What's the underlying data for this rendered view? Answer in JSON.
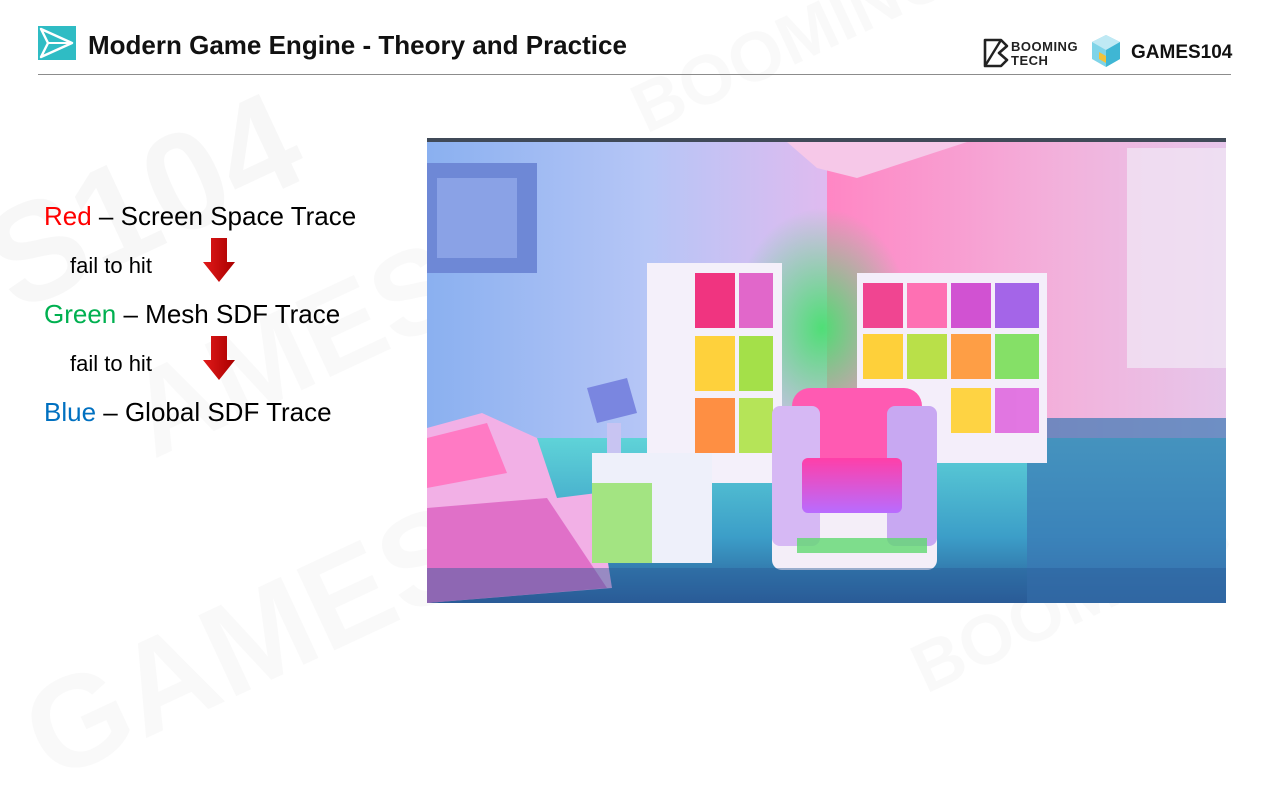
{
  "header": {
    "title": "Modern Game Engine - Theory and Practice",
    "brand_booming": "BOOMING TECH",
    "brand_games": "GAMES104"
  },
  "legend": {
    "red": {
      "color_word": "Red",
      "rest": " – Screen Space Trace",
      "color": "#ff0000"
    },
    "step1": "fail to hit",
    "green": {
      "color_word": "Green",
      "rest": " – Mesh SDF Trace",
      "color": "#00b050"
    },
    "step2": "fail to hit",
    "blue": {
      "color_word": "Blue",
      "rest": " – Global SDF Trace",
      "color": "#0070c0"
    }
  },
  "colors": {
    "accent_teal": "#2fbcc4",
    "arrow_red": "#c00000",
    "rule": "#8c8c8c"
  },
  "icons": [
    "play-triangle-icon",
    "booming-tech-logo",
    "games104-cube-logo",
    "down-arrow-icon"
  ],
  "watermark": "GAMES104"
}
